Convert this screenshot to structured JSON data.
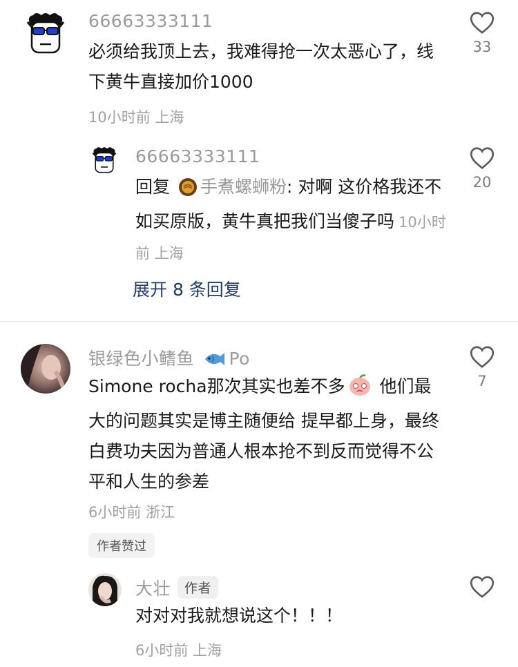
{
  "comments": [
    {
      "username": "66663333111",
      "text": "必须给我顶上去，我难得抢一次太恶心了，线下黄牛直接加价1000",
      "meta": "10小时前 上海",
      "likes": "33",
      "reply": {
        "username": "66663333111",
        "prefix": "回复",
        "mention": "手煮螺蛳粉",
        "text": ": 对啊 这价格我还不如买原版，黄牛真把我们当傻子吗",
        "meta": "10小时前 上海",
        "likes": "20"
      },
      "expand_label": "展开 8 条回复"
    },
    {
      "username": "银绿色小鳍鱼",
      "username_suffix": "Po",
      "text_before_emoji": "Simone rocha那次其实也差不多",
      "text_after_emoji": " 他们最大的问题其实是博主随便给 提早都上身，最终白费功夫因为普通人根本抢不到反而觉得不公平和人生的参差",
      "meta": "6小时前 浙江",
      "likes": "7",
      "badge": "作者赞过",
      "reply": {
        "username": "大壮",
        "author_tag": "作者",
        "text": "对对对我就想说这个！！！",
        "meta": "6小时前 上海"
      }
    }
  ],
  "colors": {
    "username": "#9a9a9a",
    "text": "#1a1a1a",
    "link": "#1f3a6b",
    "meta": "#a0a0a0"
  },
  "icons": [
    "cartoon-avatar-icon",
    "heart-outline-icon",
    "fish-emoji-icon",
    "peach-emoji-icon",
    "noodle-avatar-icon"
  ]
}
